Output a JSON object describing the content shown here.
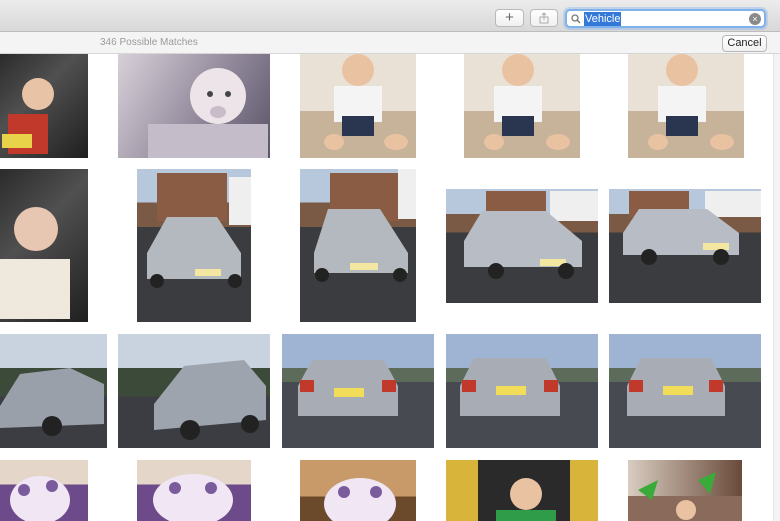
{
  "toolbar": {
    "add_label": "+",
    "share_label": "⇪"
  },
  "search": {
    "value": "Vehicle",
    "clear_label": "×"
  },
  "results": {
    "match_count": "346 Possible Matches",
    "cancel_label": "Cancel"
  },
  "colors": {
    "search_focus": "#7fb1ea",
    "selection": "#3478d8"
  },
  "icons": [
    "plus-icon",
    "share-icon",
    "search-icon",
    "clear-icon"
  ]
}
